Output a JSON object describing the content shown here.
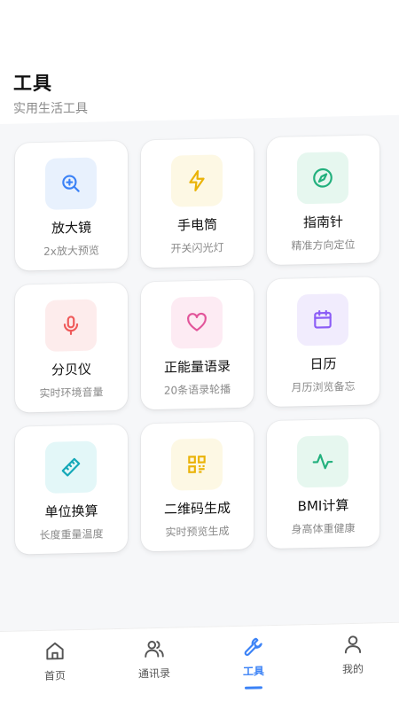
{
  "header": {
    "title": "工具",
    "subtitle": "实用生活工具"
  },
  "tools": [
    {
      "title": "放大镜",
      "desc": "2x放大预览",
      "icon": "zoom-in-icon",
      "color": "#3b82f6",
      "bg": "#e8f1fd"
    },
    {
      "title": "手电筒",
      "desc": "开关闪光灯",
      "icon": "lightning-icon",
      "color": "#eab308",
      "bg": "#fdf8e4"
    },
    {
      "title": "指南针",
      "desc": "精准方向定位",
      "icon": "compass-icon",
      "color": "#22b07d",
      "bg": "#e6f7ef"
    },
    {
      "title": "分贝仪",
      "desc": "实时环境音量",
      "icon": "microphone-icon",
      "color": "#ef5a5a",
      "bg": "#fdecec"
    },
    {
      "title": "正能量语录",
      "desc": "20条语录轮播",
      "icon": "heart-icon",
      "color": "#e2559a",
      "bg": "#fdebf3"
    },
    {
      "title": "日历",
      "desc": "月历浏览备忘",
      "icon": "calendar-icon",
      "color": "#8b5cf6",
      "bg": "#f1ecfd"
    },
    {
      "title": "单位换算",
      "desc": "长度重量温度",
      "icon": "ruler-icon",
      "color": "#14a8b8",
      "bg": "#e3f7f8"
    },
    {
      "title": "二维码生成",
      "desc": "实时预览生成",
      "icon": "qrcode-icon",
      "color": "#eab308",
      "bg": "#fdf8e4"
    },
    {
      "title": "BMI计算",
      "desc": "身高体重健康",
      "icon": "activity-icon",
      "color": "#22b07d",
      "bg": "#e6f7ef"
    }
  ],
  "nav": {
    "items": [
      {
        "label": "首页",
        "icon": "home-icon"
      },
      {
        "label": "通讯录",
        "icon": "contacts-icon"
      },
      {
        "label": "工具",
        "icon": "wrench-icon"
      },
      {
        "label": "我的",
        "icon": "user-icon"
      }
    ],
    "active": 2,
    "active_color": "#3b82f6",
    "inactive_color": "#555555"
  }
}
